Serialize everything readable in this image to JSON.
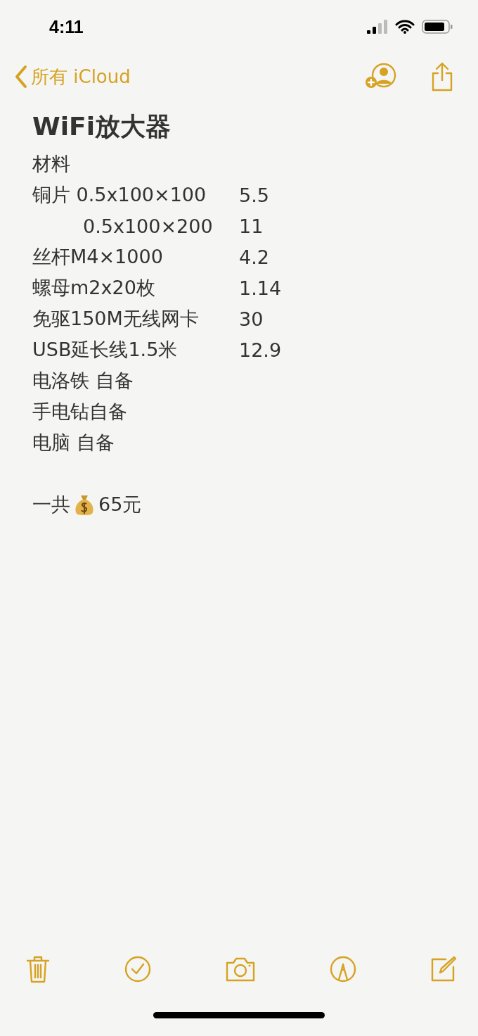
{
  "status_bar": {
    "time": "4:11"
  },
  "nav": {
    "back_label": "所有 iCloud"
  },
  "note": {
    "title": "WiFi放大器",
    "lines": [
      {
        "text": "材料"
      },
      {
        "text": "铜片 0.5x100×100",
        "price": "5.5",
        "children": [
          {
            "text": "0.5x100×200",
            "price": "11"
          }
        ]
      },
      {
        "text": "丝杆M4×1000",
        "price": "4.2"
      },
      {
        "text": "螺母m2x20枚",
        "price": "1.14"
      },
      {
        "text": "免驱150M无线网卡",
        "price": "30"
      },
      {
        "text": "USB延长线1.5米",
        "price": "12.9"
      },
      {
        "text": "电洛铁 自备"
      },
      {
        "text": "手电钻自备"
      },
      {
        "text": "电脑 自备"
      }
    ],
    "total": {
      "label": "一共",
      "amount": "65元"
    }
  }
}
